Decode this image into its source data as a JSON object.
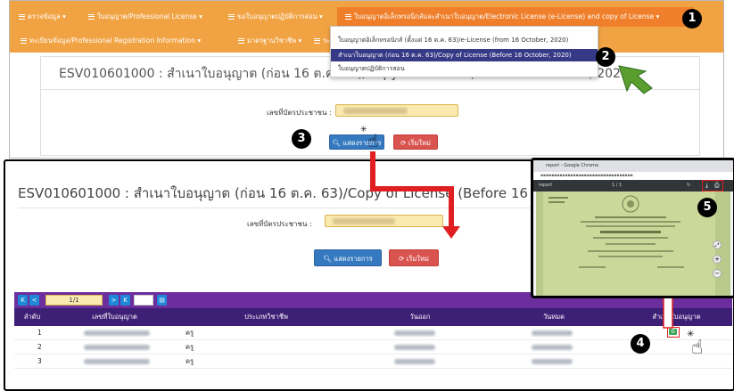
{
  "nav": {
    "row1": [
      "ตรวจข้อมูล",
      "ใบอนุญาต/Professional License",
      "ขอใบอนุญาตปฏิบัติการสอน",
      "ใบอนุญาตอิเล็กทรอนิกส์และสำเนาใบอนุญาต/Electronic License (e-License) and copy of License"
    ],
    "row2": [
      "ทะเบียนข้อมูล/Professional Registration Information",
      "มาตรฐานวิชาชีพ",
      "ระ"
    ]
  },
  "dropdown": {
    "items": [
      "ใบอนุญาตอิเล็กทรอนิกส์ (ตั้งแต่ 16 ต.ค. 63)/e-License (from 16 October, 2020)",
      "สำเนาใบอนุญาต (ก่อน 16 ต.ค. 63)/Copy of License (Before 16 October, 2020)",
      "ใบอนุญาตปฏิบัติการสอน"
    ],
    "selected_index": 1
  },
  "top_form": {
    "title": "ESV010601000 : สำเนาใบอนุญาต (ก่อน 16 ต.ค. 63)/Copy of License (Before 16 October, 2020)",
    "id_label": "เลขที่บัตรประชาชน :",
    "show_button": "แสดงรายการ",
    "reset_button": "เริ่มใหม่"
  },
  "bottom_form": {
    "title": "ESV010601000 : สำเนาใบอนุญาต (ก่อน 16 ต.ค. 63)/Copy of License (Before 16 Octobe",
    "id_label": "เลขที่บัตรประชาชน :",
    "show_button": "แสดงรายการ",
    "reset_button": "เริ่มใหม่"
  },
  "pager": {
    "page_indicator": "1/1",
    "buttons": [
      "K",
      "<",
      ">",
      "K"
    ]
  },
  "table": {
    "headers": [
      "ลำดับ",
      "เลขที่ใบอนุญาต",
      "ประเภทวิชาชีพ",
      "วันออก",
      "วันหมด",
      "สำเนาใบอนุญาต"
    ],
    "rows": [
      {
        "no": "1",
        "type": "ครู"
      },
      {
        "no": "2",
        "type": "ครู"
      },
      {
        "no": "3",
        "type": "ครู"
      }
    ]
  },
  "popup": {
    "window_title": "report - Google Chrome",
    "toolbar_title": "report",
    "page_count": "1 / 1"
  },
  "callouts": [
    "1",
    "2",
    "3",
    "4",
    "5"
  ],
  "colors": {
    "nav_orange": "#f1a343",
    "dropdown_selected": "#363985",
    "table_header": "#3d1f76",
    "pager_bar": "#6d2e9d",
    "button_blue": "#3579c0",
    "button_red": "#d9534f",
    "callout_arrow": "#e02020",
    "pointer_green": "#5a9e2f"
  }
}
